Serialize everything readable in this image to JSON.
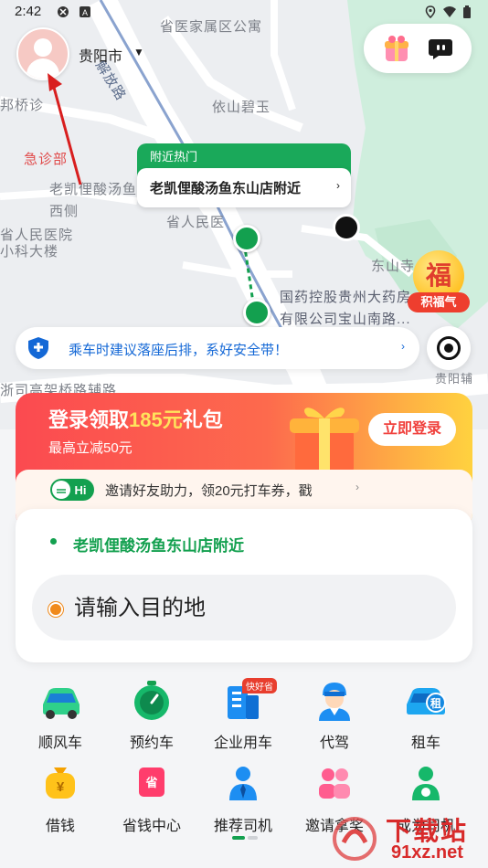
{
  "status_bar": {
    "time": "2:42"
  },
  "top_bar": {
    "city": "贵阳市",
    "city_chevron": "⌄"
  },
  "map": {
    "labels": {
      "l1": "省医家属区公寓",
      "l2": "依山碧玉",
      "l3": "急诊部",
      "l4": "老凯俚酸汤鱼东山店",
      "l5": "西侧",
      "l6": "省人民医院",
      "l7": "小科大楼",
      "l8": "省人民医",
      "l9": "东山寺",
      "l10": "国药控股贵州大药房",
      "l11": "有限公司宝山南路...",
      "l12": "浙司高架桥路辅路",
      "l13": "贵阳辅",
      "l14": "邦桥诊",
      "l15": "解放路"
    },
    "hot_header": "附近热门",
    "hot_place": "老凯俚酸汤鱼东山店附近",
    "fu_badge": {
      "char": "福",
      "label": "积福气"
    }
  },
  "safety_banner": {
    "text": "乘车时建议落座后排，系好安全带！"
  },
  "promo": {
    "title_pre": "登录领取",
    "title_amount": "185元",
    "title_post": "礼包",
    "subtitle": "最高立减50元",
    "login_button": "立即登录",
    "hi_badge": "Hi",
    "invite_text": "邀请好友助力，领20元打车券，戳"
  },
  "booking": {
    "pickup": "老凯俚酸汤鱼东山店附近",
    "destination_placeholder": "请输入目的地"
  },
  "services_row1": [
    {
      "label": "顺风车",
      "icon": "car-icon"
    },
    {
      "label": "预约车",
      "icon": "clock-icon"
    },
    {
      "label": "企业用车",
      "icon": "building-icon",
      "badge": "快好省"
    },
    {
      "label": "代驾",
      "icon": "driver-icon"
    },
    {
      "label": "租车",
      "icon": "rental-car-icon",
      "badge_char": "租"
    }
  ],
  "services_row2": [
    {
      "label": "借钱",
      "icon": "money-bag-icon",
      "glyph": "¥"
    },
    {
      "label": "省钱中心",
      "icon": "coupon-icon",
      "glyph": "省"
    },
    {
      "label": "推荐司机",
      "icon": "person-tie-icon"
    },
    {
      "label": "邀请拿奖",
      "icon": "people-icon"
    },
    {
      "label": "成为司机",
      "icon": "driver-person-icon"
    }
  ],
  "watermark": {
    "text": "下载站",
    "url": "91xz.net"
  },
  "colors": {
    "brand_green": "#13a04f",
    "promo_red": "#fb4a50",
    "safety_blue": "#1468d6"
  }
}
